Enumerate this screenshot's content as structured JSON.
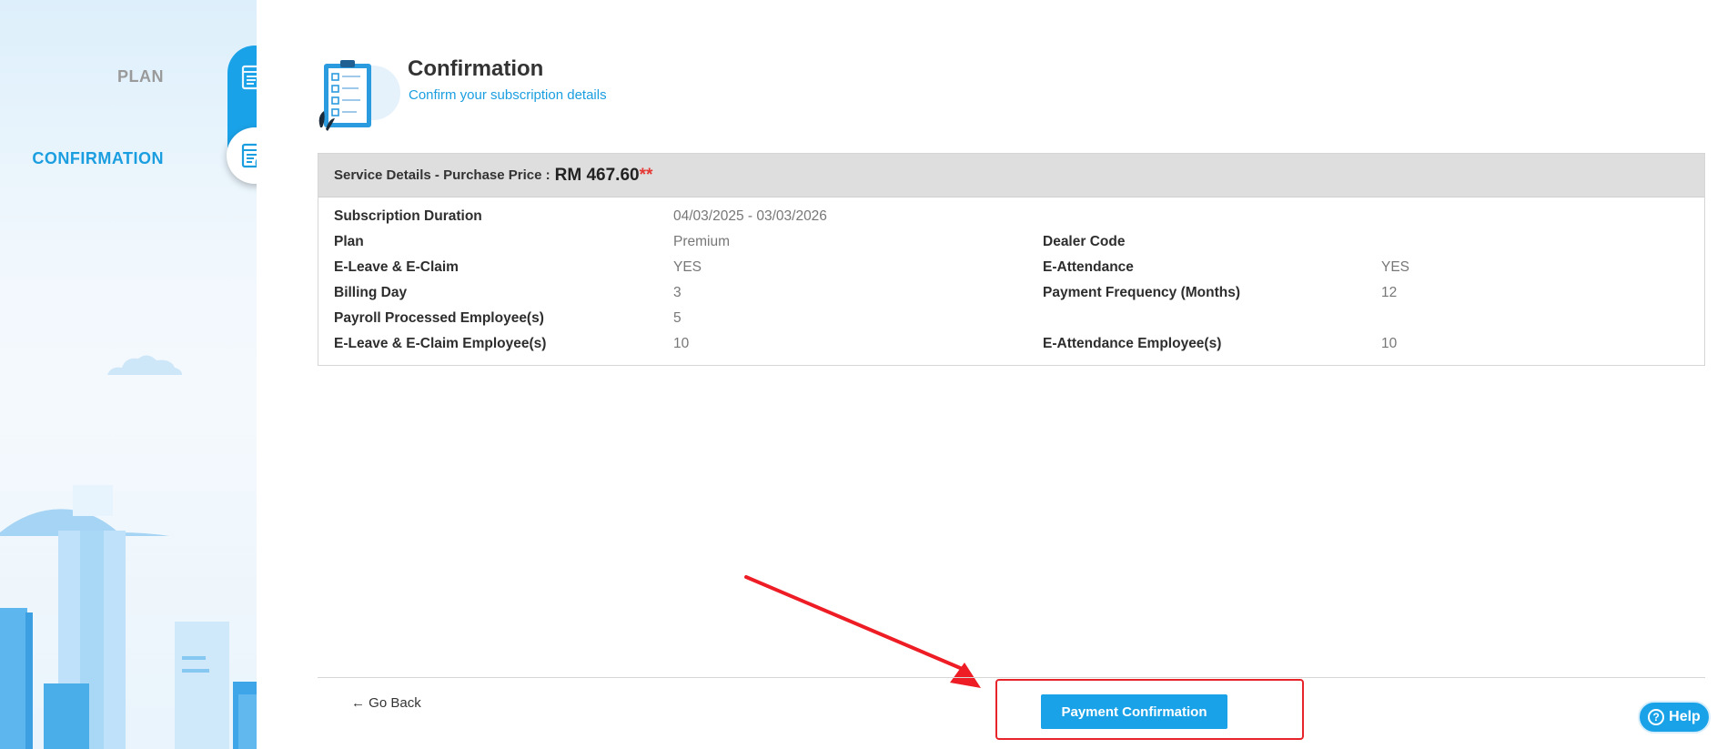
{
  "sidebar": {
    "steps": [
      {
        "label": "PLAN",
        "state": "done"
      },
      {
        "label": "CONFIRMATION",
        "state": "active"
      }
    ]
  },
  "header": {
    "title": "Confirmation",
    "subtitle": "Confirm your subscription details"
  },
  "service": {
    "header_label": "Service Details - Purchase Price :",
    "price": "RM 467.60",
    "price_marker": "**",
    "left_fields": [
      {
        "label": "Subscription Duration",
        "value": "04/03/2025 - 03/03/2026"
      },
      {
        "label": "Plan",
        "value": "Premium"
      },
      {
        "label": "E-Leave & E-Claim",
        "value": "YES"
      },
      {
        "label": "Billing Day",
        "value": "3"
      },
      {
        "label": "Payroll Processed Employee(s)",
        "value": "5"
      },
      {
        "label": "E-Leave & E-Claim Employee(s)",
        "value": "10"
      }
    ],
    "right_fields": [
      {
        "label": "Dealer Code",
        "value": ""
      },
      {
        "label": "E-Attendance",
        "value": "YES"
      },
      {
        "label": "Payment Frequency (Months)",
        "value": "12"
      },
      {
        "label": "E-Attendance Employee(s)",
        "value": "10"
      }
    ]
  },
  "footer": {
    "back_label": "← Go Back",
    "pay_label": "Payment Confirmation"
  },
  "help": {
    "label": "Help"
  },
  "colors": {
    "accent": "#1aa2e8",
    "highlight": "#e8242b",
    "price_marker": "#e53935"
  }
}
